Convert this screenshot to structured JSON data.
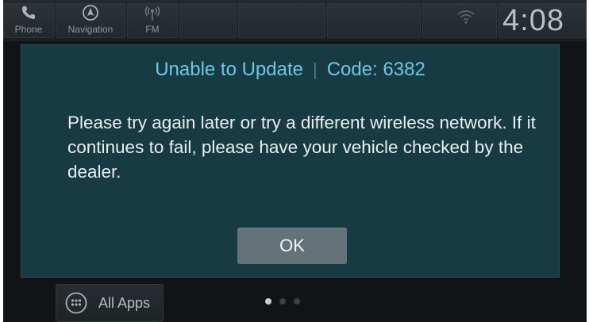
{
  "topbar": {
    "shortcuts": [
      {
        "label": "Phone",
        "icon": "phone-icon"
      },
      {
        "label": "Navigation",
        "icon": "navigation-icon"
      },
      {
        "label": "FM",
        "icon": "radio-icon"
      }
    ],
    "wifi_icon": "wifi-icon",
    "time": "4:08"
  },
  "dialog": {
    "title": "Unable to Update",
    "separator": "|",
    "code": "Code: 6382",
    "message": "Please try again later or try a different wireless network. If it continues to fail, please have your vehicle checked by the dealer.",
    "ok_label": "OK"
  },
  "bottombar": {
    "all_apps_label": "All Apps",
    "all_apps_icon": "apps-grid-icon",
    "pages": 3,
    "active_page": 1
  },
  "colors": {
    "dialog_bg": "#173a43",
    "title_accent": "#6cc8e4",
    "button_bg": "#637379"
  }
}
